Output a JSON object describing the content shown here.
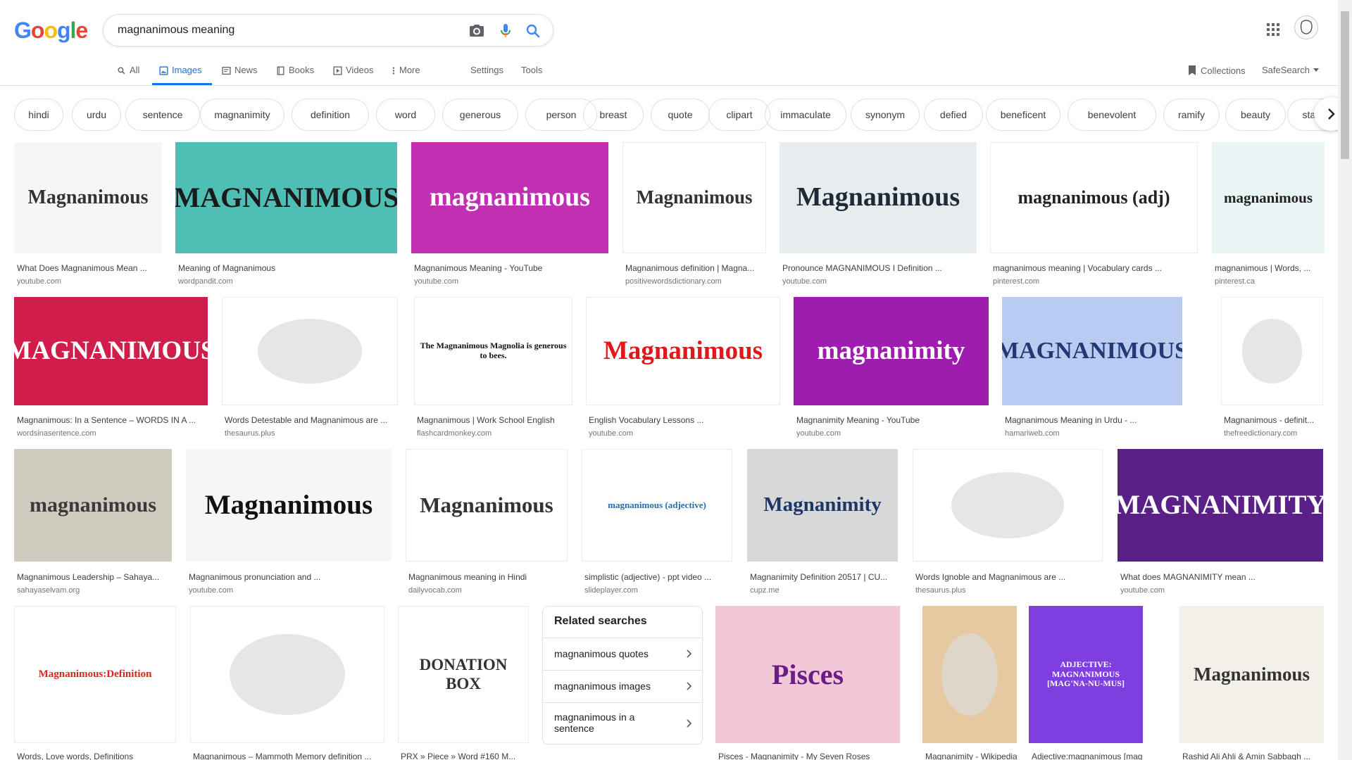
{
  "logo": {
    "letters": [
      "G",
      "o",
      "o",
      "g",
      "l",
      "e"
    ],
    "colors": [
      "#4285f4",
      "#ea4335",
      "#fbbc05",
      "#4285f4",
      "#34a853",
      "#ea4335"
    ]
  },
  "search": {
    "query": "magnanimous meaning"
  },
  "tabs": [
    {
      "label": "All",
      "icon": "search-icon"
    },
    {
      "label": "Images",
      "icon": "image-icon"
    },
    {
      "label": "News",
      "icon": "news-icon"
    },
    {
      "label": "Books",
      "icon": "book-icon"
    },
    {
      "label": "Videos",
      "icon": "video-icon"
    },
    {
      "label": "More",
      "icon": "more-icon"
    },
    {
      "label": "Settings",
      "icon": ""
    },
    {
      "label": "Tools",
      "icon": ""
    }
  ],
  "right_tools": {
    "collections": "Collections",
    "safesearch": "SafeSearch"
  },
  "chips": [
    "hindi",
    "urdu",
    "sentence",
    "magnanimity",
    "definition",
    "word",
    "generous",
    "person",
    "breast",
    "quote",
    "clipart",
    "immaculate",
    "synonym",
    "defied",
    "beneficent",
    "benevolent",
    "ramify",
    "beauty",
    "staunch"
  ],
  "results": [
    {
      "title": "What Does Magnanimous Mean ...",
      "source": "youtube.com",
      "thumb_text": "Magnanimous",
      "bg": "#f4f6f8",
      "fg": "#333333"
    },
    {
      "title": "Meaning of Magnanimous",
      "source": "wordpandit.com",
      "thumb_text": "MAGNANIMOUS",
      "bg": "#4fbfb6",
      "fg": "#1a1a1a"
    },
    {
      "title": "Magnanimous Meaning - YouTube",
      "source": "youtube.com",
      "thumb_text": "magnanimous",
      "bg": "#c12fb3",
      "fg": "#ffffff"
    },
    {
      "title": "Magnanimous definition | Magna...",
      "source": "positivewordsdictionary.com",
      "thumb_text": "Magnanimous",
      "bg": "#ffffff",
      "fg": "#333333"
    },
    {
      "title": "Pronounce MAGNANIMOUS I Definition ...",
      "source": "youtube.com",
      "thumb_text": "Magnanimous",
      "bg": "#e7ecef",
      "fg": "#1e2a36"
    },
    {
      "title": "magnanimous meaning | Vocabulary cards ...",
      "source": "pinterest.com",
      "thumb_text": "magnanimous (adj)",
      "bg": "#ffffff",
      "fg": "#222222"
    },
    {
      "title": "magnanimous | Words, ...",
      "source": "pinterest.ca",
      "thumb_text": "magnanimous",
      "bg": "#e9f5f4",
      "fg": "#222222"
    },
    {
      "title": "Magnanimous: In a Sentence – WORDS IN A ...",
      "source": "wordsinasentence.com",
      "thumb_text": "MAGNANIMOUS",
      "bg": "#d11d4c",
      "fg": "#ffffff"
    },
    {
      "title": "Words Detestable and Magnanimous are ...",
      "source": "thesaurus.plus",
      "thumb_text": "",
      "bg": "#ffffff",
      "fg": "#333333"
    },
    {
      "title": "Magnanimous | Work School English",
      "source": "flashcardmonkey.com",
      "thumb_text": "The Magnanimous Magnolia is generous to bees.",
      "bg": "#ffffff",
      "fg": "#111111"
    },
    {
      "title": "English Vocabulary Lessons ...",
      "source": "youtube.com",
      "thumb_text": "Magnanimous",
      "bg": "#ffffff",
      "fg": "#e2171a"
    },
    {
      "title": "Magnanimity Meaning - YouTube",
      "source": "youtube.com",
      "thumb_text": "magnanimity",
      "bg": "#9e1cae",
      "fg": "#ffffff"
    },
    {
      "title": "Magnanimous Meaning in Urdu - ...",
      "source": "hamariweb.com",
      "thumb_text": "MAGNANIMOUS",
      "bg": "#b9cbf0",
      "fg": "#1f3a75"
    },
    {
      "title": "Magnanimous - definit...",
      "source": "thefreedictionary.com",
      "thumb_text": "",
      "bg": "#ffffff",
      "fg": "#333333"
    },
    {
      "title": "Magnanimous Leadership – Sahaya...",
      "source": "sahayaselvam.org",
      "thumb_text": "magnanimous",
      "bg": "#cfcbbf",
      "fg": "#3a3a3a"
    },
    {
      "title": "Magnanimous pronunciation and ...",
      "source": "youtube.com",
      "thumb_text": "Magnanimous",
      "bg": "#f6f6f6",
      "fg": "#111111"
    },
    {
      "title": "Magnanimous meaning in Hindi",
      "source": "dailyvocab.com",
      "thumb_text": "Magnanimous",
      "bg": "#ffffff",
      "fg": "#333333"
    },
    {
      "title": "simplistic (adjective) - ppt video ...",
      "source": "slideplayer.com",
      "thumb_text": "magnanimous (adjective)",
      "bg": "#ffffff",
      "fg": "#2b6da8"
    },
    {
      "title": "Magnanimity Definition 20517 | CU...",
      "source": "cupz.me",
      "thumb_text": "Magnanimity",
      "bg": "#d8d8d8",
      "fg": "#1c3766"
    },
    {
      "title": "Words Ignoble and Magnanimous are ...",
      "source": "thesaurus.plus",
      "thumb_text": "",
      "bg": "#ffffff",
      "fg": "#333333"
    },
    {
      "title": "What does MAGNANIMITY mean ...",
      "source": "youtube.com",
      "thumb_text": "MAGNANIMITY",
      "bg": "#5b2087",
      "fg": "#ffffff"
    },
    {
      "title": "Words, Love words, Definitions",
      "source": "",
      "thumb_text": "Magnanimous:Definition",
      "bg": "#ffffff",
      "fg": "#e0231c"
    },
    {
      "title": "Magnanimous – Mammoth Memory definition ...",
      "source": "",
      "thumb_text": "",
      "bg": "#ffffff",
      "fg": "#333333"
    },
    {
      "title": "PRX » Piece » Word #160 M...",
      "source": "",
      "thumb_text": "DONATION BOX",
      "bg": "#ffffff",
      "fg": "#333333"
    },
    {
      "title": "Pisces - Magnanimity - My Seven Roses",
      "source": "",
      "thumb_text": "Pisces",
      "bg": "#f2c7d7",
      "fg": "#6a1d85"
    },
    {
      "title": "Magnanimity - Wikipedia",
      "source": "",
      "thumb_text": "",
      "bg": "#e6c9a0",
      "fg": "#5a3b1c"
    },
    {
      "title": "Adjective:magnanimous [mag ...",
      "source": "",
      "thumb_text": "ADJECTIVE: MAGNANIMOUS [MAG'NA-NU-MUS]",
      "bg": "#7f3fe0",
      "fg": "#ffffff"
    },
    {
      "title": "Rashid Ali Ahli & Amin Sabbagh ...",
      "source": "",
      "thumb_text": "Magnanimous",
      "bg": "#f3f0ea",
      "fg": "#333333"
    }
  ],
  "related": {
    "title": "Related searches",
    "items": [
      "magnanimous quotes",
      "magnanimous images",
      "magnanimous in a sentence"
    ]
  }
}
